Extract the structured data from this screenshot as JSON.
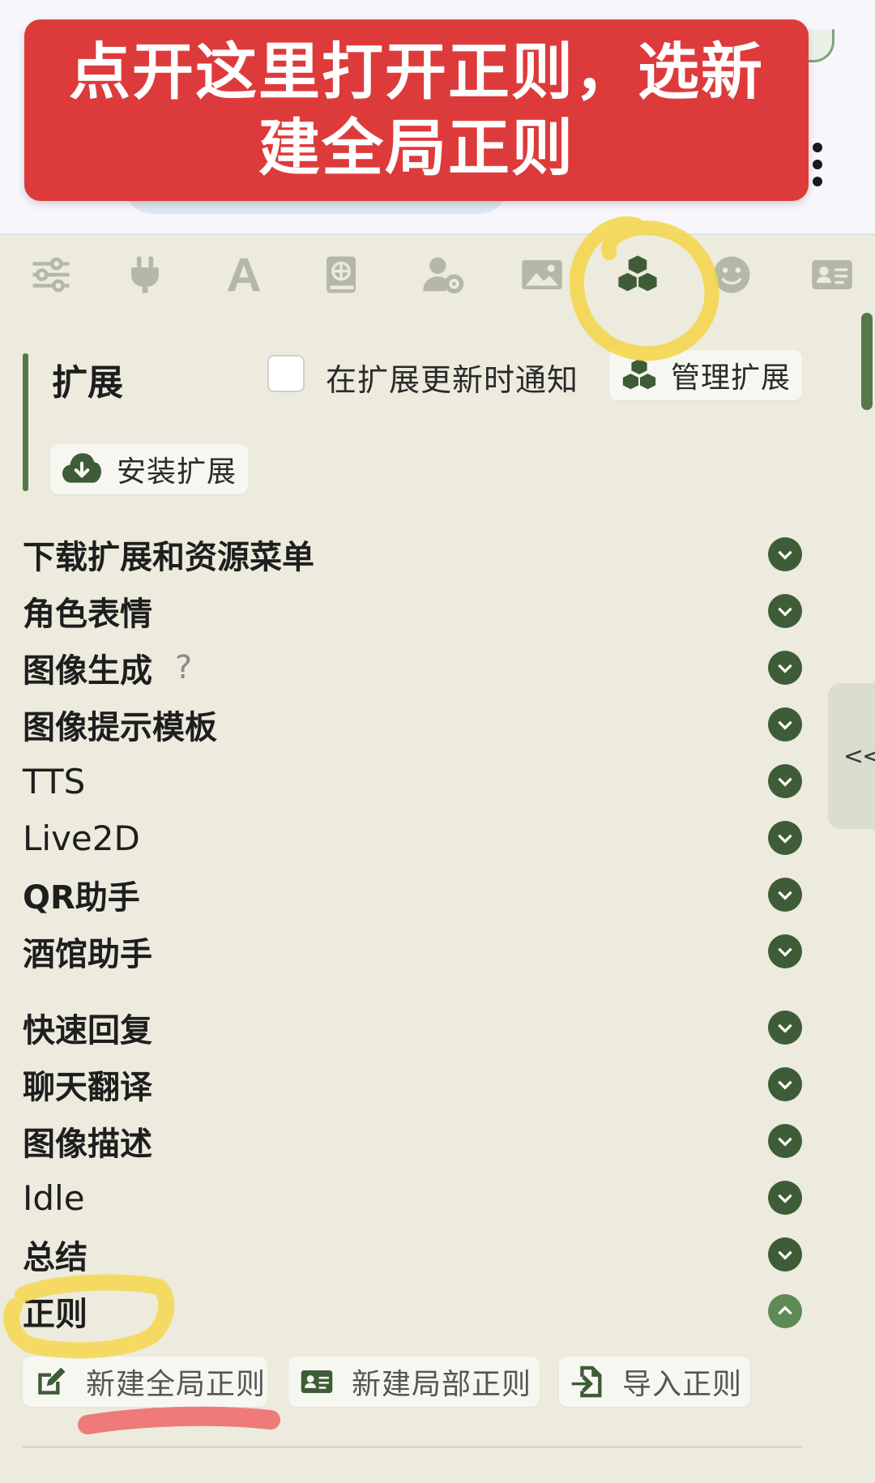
{
  "banner": {
    "text": "点开这里打开正则，选新建全局正则"
  },
  "icons": {
    "tabs": [
      "sliders-icon",
      "plug-icon",
      "font-icon",
      "book-globe-icon",
      "user-gear-icon",
      "image-icon",
      "cubes-icon",
      "smile-icon",
      "id-card-icon"
    ],
    "manage": "cubes-icon",
    "install": "cloud-download-icon",
    "new_global": "edit-icon",
    "new_local": "id-card-icon",
    "import": "file-import-icon"
  },
  "extensions": {
    "title": "扩展",
    "notify_label": "在扩展更新时通知",
    "manage_button": "管理扩展",
    "install_button": "安装扩展"
  },
  "list": {
    "items": [
      {
        "label": "下载扩展和资源菜单"
      },
      {
        "label": "角色表情"
      },
      {
        "label": "图像生成",
        "help": "?"
      },
      {
        "label": "图像提示模板"
      },
      {
        "label": "TTS"
      },
      {
        "label": "Live2D"
      },
      {
        "label": "QR助手"
      },
      {
        "label": "酒馆助手"
      },
      {
        "label": "快速回复"
      },
      {
        "label": "聊天翻译"
      },
      {
        "label": "图像描述"
      },
      {
        "label": "Idle"
      },
      {
        "label": "总结"
      },
      {
        "label": "正则"
      }
    ]
  },
  "side_tab": {
    "label": "<<"
  },
  "regex": {
    "new_global": "新建全局正则",
    "new_local": "新建局部正则",
    "import": "导入正则"
  },
  "colors": {
    "accent": "#3e5c37",
    "banner": "#dd3b3b",
    "highlight_yellow": "#f5d547",
    "underline_red": "#ee6f6f",
    "background": "#ecebdd"
  }
}
